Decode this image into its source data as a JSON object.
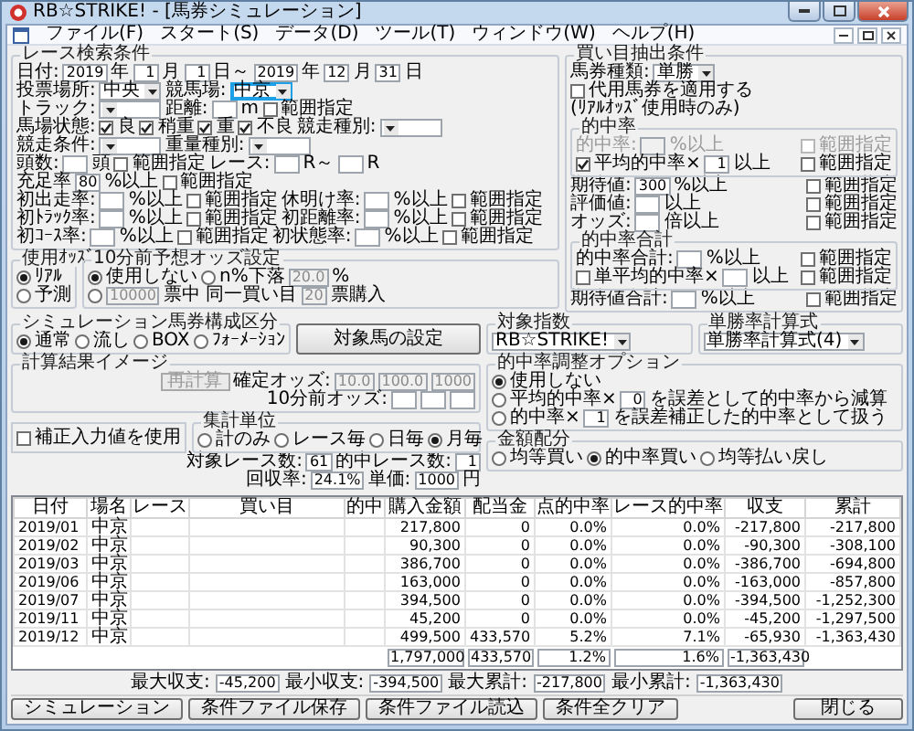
{
  "window": {
    "title": "RB☆STRIKE! - [馬券シミュレーション]"
  },
  "menu": [
    "ファイル(F)",
    "スタート(S)",
    "データ(D)",
    "ツール(T)",
    "ウィンドウ(W)",
    "ヘルプ(H)"
  ],
  "race_conditions": {
    "title": "レース検索条件",
    "rows": [
      {
        "parts": [
          {
            "kind": "label",
            "text": "日付:"
          },
          {
            "kind": "field",
            "value": "2019"
          },
          {
            "kind": "label",
            "text": "年"
          },
          {
            "kind": "field",
            "value": "1"
          },
          {
            "kind": "label",
            "text": "月"
          },
          {
            "kind": "field",
            "value": "1"
          },
          {
            "kind": "label",
            "text": "日～"
          },
          {
            "kind": "field",
            "value": "2019"
          },
          {
            "kind": "label",
            "text": "年"
          },
          {
            "kind": "field",
            "value": "12"
          },
          {
            "kind": "label",
            "text": "月"
          },
          {
            "kind": "field",
            "value": "31"
          },
          {
            "kind": "label",
            "text": "日"
          }
        ]
      },
      {
        "parts": [
          {
            "kind": "label",
            "text": "投票場所:"
          },
          {
            "kind": "select",
            "value": "中央"
          },
          {
            "kind": "label",
            "text": "競馬場:"
          },
          {
            "kind": "select",
            "value": "中京",
            "focused": true
          }
        ]
      },
      {
        "parts": [
          {
            "kind": "label",
            "text": "トラック:"
          },
          {
            "kind": "select"
          },
          {
            "kind": "label",
            "text": "距離:"
          },
          {
            "kind": "field"
          },
          {
            "kind": "label",
            "text": "m"
          },
          {
            "kind": "check",
            "label": "範囲指定",
            "checked": false
          }
        ]
      },
      {
        "parts": [
          {
            "kind": "label",
            "text": "馬場状態:"
          },
          {
            "kind": "check",
            "label": "良",
            "checked": true
          },
          {
            "kind": "check",
            "label": "稍重",
            "checked": true
          },
          {
            "kind": "check",
            "label": "重",
            "checked": true
          },
          {
            "kind": "check",
            "label": "不良",
            "checked": true
          },
          {
            "kind": "label",
            "text": "競走種別:"
          },
          {
            "kind": "select"
          }
        ]
      },
      {
        "parts": [
          {
            "kind": "label",
            "text": "競走条件:"
          },
          {
            "kind": "select"
          },
          {
            "kind": "label",
            "text": "重量種別:"
          },
          {
            "kind": "select"
          }
        ]
      },
      {
        "parts": [
          {
            "kind": "label",
            "text": "頭数:"
          },
          {
            "kind": "field"
          },
          {
            "kind": "label",
            "text": "頭"
          },
          {
            "kind": "check",
            "label": "範囲指定",
            "checked": false
          },
          {
            "kind": "label",
            "text": "レース:"
          },
          {
            "kind": "field"
          },
          {
            "kind": "label",
            "text": "R～"
          },
          {
            "kind": "field"
          },
          {
            "kind": "label",
            "text": "R"
          }
        ]
      },
      {
        "parts": [
          {
            "kind": "label",
            "text": "充足率"
          },
          {
            "kind": "field",
            "value": "80"
          },
          {
            "kind": "label",
            "text": "%以上"
          },
          {
            "kind": "check",
            "label": "範囲指定",
            "checked": false
          }
        ]
      },
      {
        "parts": [
          {
            "kind": "label",
            "text": "初出走率:"
          },
          {
            "kind": "field"
          },
          {
            "kind": "label",
            "text": "%以上"
          },
          {
            "kind": "check",
            "label": "範囲指定",
            "checked": false
          },
          {
            "kind": "label",
            "text": "休明け率:"
          },
          {
            "kind": "field"
          },
          {
            "kind": "label",
            "text": "%以上"
          },
          {
            "kind": "check",
            "label": "範囲指定",
            "checked": false
          }
        ]
      },
      {
        "parts": [
          {
            "kind": "label",
            "text": "初ﾄﾗｯｸ率:"
          },
          {
            "kind": "field"
          },
          {
            "kind": "label",
            "text": "%以上"
          },
          {
            "kind": "check",
            "label": "範囲指定",
            "checked": false
          },
          {
            "kind": "label",
            "text": "初距離率:"
          },
          {
            "kind": "field"
          },
          {
            "kind": "label",
            "text": "%以上"
          },
          {
            "kind": "check",
            "label": "範囲指定",
            "checked": false
          }
        ]
      },
      {
        "parts": [
          {
            "kind": "label",
            "text": "初ｺｰｽ率:"
          },
          {
            "kind": "field"
          },
          {
            "kind": "label",
            "text": "%以上"
          },
          {
            "kind": "check",
            "label": "範囲指定",
            "checked": false
          },
          {
            "kind": "label",
            "text": "初状態率:"
          },
          {
            "kind": "field"
          },
          {
            "kind": "label",
            "text": "%以上"
          },
          {
            "kind": "check",
            "label": "範囲指定",
            "checked": false
          }
        ]
      }
    ]
  },
  "bet_conditions": {
    "title": "買い目抽出条件",
    "rows": [
      {
        "parts": [
          {
            "kind": "label",
            "text": "馬券種類:"
          },
          {
            "kind": "select",
            "value": "単勝"
          }
        ]
      },
      {
        "parts": [
          {
            "kind": "check",
            "label": "代用馬券を適用する",
            "checked": false
          }
        ]
      },
      {
        "parts": [
          {
            "kind": "label",
            "text": "(ﾘｱﾙｵｯｽﾞ使用時のみ)"
          }
        ]
      },
      {
        "title": "的中率",
        "rows": [
          {
            "parts": [
              {
                "kind": "label",
                "text": "的中率:",
                "disabled": true
              },
              {
                "kind": "field",
                "disabled": true
              },
              {
                "kind": "label",
                "text": "%以上",
                "disabled": true
              },
              {
                "kind": "check",
                "label": "範囲指定",
                "checked": false,
                "disabled": true
              }
            ]
          },
          {
            "parts": [
              {
                "kind": "check",
                "label": "平均的中率×",
                "checked": true
              },
              {
                "kind": "field",
                "value": "1"
              },
              {
                "kind": "label",
                "text": "以上"
              },
              {
                "kind": "check",
                "label": "範囲指定",
                "checked": false
              }
            ]
          }
        ]
      },
      {
        "parts": [
          {
            "kind": "label",
            "text": "期待値:"
          },
          {
            "kind": "field",
            "value": "300"
          },
          {
            "kind": "label",
            "text": "%以上"
          },
          {
            "kind": "check",
            "label": "範囲指定",
            "checked": false
          }
        ]
      },
      {
        "parts": [
          {
            "kind": "label",
            "text": "評価値:"
          },
          {
            "kind": "field"
          },
          {
            "kind": "label",
            "text": "以上"
          },
          {
            "kind": "check",
            "label": "範囲指定",
            "checked": false
          }
        ]
      },
      {
        "parts": [
          {
            "kind": "label",
            "text": "オッズ:"
          },
          {
            "kind": "field"
          },
          {
            "kind": "label",
            "text": "倍以上"
          },
          {
            "kind": "check",
            "label": "範囲指定",
            "checked": false
          }
        ]
      },
      {
        "title": "的中率合計",
        "rows": [
          {
            "parts": [
              {
                "kind": "label",
                "text": "的中率合計:"
              },
              {
                "kind": "field"
              },
              {
                "kind": "label",
                "text": "%以上"
              },
              {
                "kind": "check",
                "label": "範囲指定",
                "checked": false
              }
            ]
          },
          {
            "parts": [
              {
                "kind": "check",
                "label": "単平均的中率×",
                "checked": false
              },
              {
                "kind": "field"
              },
              {
                "kind": "label",
                "text": "以上"
              },
              {
                "kind": "check",
                "label": "範囲指定",
                "checked": false
              }
            ]
          }
        ]
      },
      {
        "parts": [
          {
            "kind": "label",
            "text": "期待値合計:"
          },
          {
            "kind": "field"
          },
          {
            "kind": "label",
            "text": "%以上"
          },
          {
            "kind": "check",
            "label": "範囲指定",
            "checked": false
          }
        ]
      }
    ]
  },
  "simulation": {
    "composition": {
      "title": "シミュレーション馬券構成区分",
      "rows": [
        {
          "parts": [
            {
              "kind": "radio",
              "label": "通常",
              "selected": true
            },
            {
              "kind": "radio",
              "label": "流し",
              "selected": false
            },
            {
              "kind": "radio",
              "label": "BOX",
              "selected": false
            },
            {
              "kind": "radio",
              "label": "ﾌｫｰﾒｰｼｮﾝ",
              "selected": false
            }
          ]
        }
      ]
    },
    "target_button": "対象馬の設定",
    "odds_use": {
      "title": "使用ｵｯｽﾞ",
      "rows": [
        {
          "parts": [
            {
              "kind": "radio",
              "label": "ﾘｱﾙ",
              "selected": true
            }
          ]
        },
        {
          "parts": [
            {
              "kind": "radio",
              "label": "予測",
              "selected": false
            }
          ]
        }
      ]
    },
    "pre_odds": {
      "title": "10分前予想オッズ設定",
      "rows": [
        {
          "parts": [
            {
              "kind": "radio",
              "label": "使用しない",
              "selected": true
            },
            {
              "kind": "radio",
              "label": "n%下落",
              "selected": false
            },
            {
              "kind": "field",
              "value": "20.0",
              "disabled": true
            },
            {
              "kind": "label",
              "text": "%"
            }
          ]
        },
        {
          "parts": [
            {
              "kind": "radio",
              "selected": false
            },
            {
              "kind": "field",
              "value": "10000",
              "disabled": true
            },
            {
              "kind": "label",
              "text": "票中 同一買い目"
            },
            {
              "kind": "field",
              "value": "20",
              "disabled": true
            },
            {
              "kind": "label",
              "text": "票購入"
            }
          ]
        }
      ]
    },
    "result_image": {
      "title": "計算結果イメージ",
      "rows": [
        {
          "parts": [
            {
              "kind": "button",
              "label": "再計算",
              "disabled": true
            },
            {
              "kind": "label",
              "text": "確定オッズ:"
            },
            {
              "kind": "field",
              "value": "10.0",
              "disabled": true
            },
            {
              "kind": "field",
              "value": "100.0",
              "disabled": true
            },
            {
              "kind": "field",
              "value": "1000",
              "disabled": true
            }
          ]
        },
        {
          "parts": [
            {
              "kind": "label",
              "text": "10分前オッズ:"
            },
            {
              "kind": "field"
            },
            {
              "kind": "field"
            },
            {
              "kind": "field"
            }
          ]
        }
      ]
    },
    "correction": {
      "kind": "check",
      "label": "補正入力値を使用",
      "checked": false
    },
    "aggregation": {
      "title": "集計単位",
      "rows": [
        {
          "parts": [
            {
              "kind": "radio",
              "label": "計のみ",
              "selected": false
            },
            {
              "kind": "radio",
              "label": "レース毎",
              "selected": false
            },
            {
              "kind": "radio",
              "label": "日毎",
              "selected": false
            },
            {
              "kind": "radio",
              "label": "月毎",
              "selected": true
            }
          ]
        }
      ]
    },
    "allocation": {
      "title": "金額配分",
      "rows": [
        {
          "parts": [
            {
              "kind": "radio",
              "label": "均等買い",
              "selected": false
            },
            {
              "kind": "radio",
              "label": "的中率買い",
              "selected": true
            },
            {
              "kind": "radio",
              "label": "均等払い戻し",
              "selected": false
            }
          ]
        }
      ]
    },
    "index": {
      "title": "対象指数",
      "rows": [
        {
          "parts": [
            {
              "kind": "select",
              "value": "RB☆STRIKE!"
            }
          ]
        }
      ]
    },
    "formula": {
      "title": "単勝率計算式",
      "rows": [
        {
          "parts": [
            {
              "kind": "select",
              "value": "単勝率計算式(4)"
            }
          ]
        }
      ]
    },
    "adjust": {
      "title": "的中率調整オプション",
      "rows": [
        {
          "parts": [
            {
              "kind": "radio",
              "label": "使用しない",
              "selected": true
            }
          ]
        },
        {
          "parts": [
            {
              "kind": "radio",
              "label": "平均的中率×",
              "selected": false
            },
            {
              "kind": "field",
              "value": "0"
            },
            {
              "kind": "label",
              "text": "を誤差として的中率から減算"
            }
          ]
        },
        {
          "parts": [
            {
              "kind": "radio",
              "label": "的中率×",
              "selected": false
            },
            {
              "kind": "field",
              "value": "1"
            },
            {
              "kind": "label",
              "text": "を誤差補正した的中率として扱う"
            }
          ]
        }
      ]
    },
    "counts": [
      {
        "parts": [
          {
            "kind": "label",
            "text": "対象レース数:"
          },
          {
            "kind": "field",
            "value": "61"
          },
          {
            "kind": "label",
            "text": "的中レース数:"
          },
          {
            "kind": "field",
            "value": "1"
          }
        ]
      },
      {
        "parts": [
          {
            "kind": "label",
            "text": "回収率:"
          },
          {
            "kind": "field",
            "value": "24.1%"
          },
          {
            "kind": "label",
            "text": "単価:"
          },
          {
            "kind": "field",
            "value": "1000"
          },
          {
            "kind": "label",
            "text": "円"
          }
        ]
      }
    ]
  },
  "table": {
    "columns": [
      "日付",
      "場名",
      "レース",
      "買い目",
      "的中",
      "購入金額",
      "配当金",
      "点的中率",
      "レース的中率",
      "収支",
      "累計"
    ],
    "rows": [
      {
        "date": "2019/01",
        "venue": "中京",
        "amount": "217,800",
        "payout": "0",
        "point_rate": "0.0%",
        "race_rate": "0.0%",
        "balance": "-217,800",
        "total": "-217,800"
      },
      {
        "date": "2019/02",
        "venue": "中京",
        "amount": "90,300",
        "payout": "0",
        "point_rate": "0.0%",
        "race_rate": "0.0%",
        "balance": "-90,300",
        "total": "-308,100"
      },
      {
        "date": "2019/03",
        "venue": "中京",
        "amount": "386,700",
        "payout": "0",
        "point_rate": "0.0%",
        "race_rate": "0.0%",
        "balance": "-386,700",
        "total": "-694,800"
      },
      {
        "date": "2019/06",
        "venue": "中京",
        "amount": "163,000",
        "payout": "0",
        "point_rate": "0.0%",
        "race_rate": "0.0%",
        "balance": "-163,000",
        "total": "-857,800"
      },
      {
        "date": "2019/07",
        "venue": "中京",
        "amount": "394,500",
        "payout": "0",
        "point_rate": "0.0%",
        "race_rate": "0.0%",
        "balance": "-394,500",
        "total": "-1,252,300"
      },
      {
        "date": "2019/11",
        "venue": "中京",
        "amount": "45,200",
        "payout": "0",
        "point_rate": "0.0%",
        "race_rate": "0.0%",
        "balance": "-45,200",
        "total": "-1,297,500"
      },
      {
        "date": "2019/12",
        "venue": "中京",
        "amount": "499,500",
        "payout": "433,570",
        "point_rate": "5.2%",
        "race_rate": "7.1%",
        "balance": "-65,930",
        "total": "-1,363,430"
      }
    ],
    "totals": {
      "amount": "1,797,000",
      "payout": "433,570",
      "point_rate": "1.2%",
      "race_rate": "1.6%",
      "balance": "-1,363,430"
    }
  },
  "summary": [
    {
      "label": "最大収支:",
      "value": "-45,200"
    },
    {
      "label": "最小収支:",
      "value": "-394,500"
    },
    {
      "label": "最大累計:",
      "value": "-217,800"
    },
    {
      "label": "最小累計:",
      "value": "-1,363,430"
    }
  ],
  "buttons": [
    "シミュレーション",
    "条件ファイル保存",
    "条件ファイル読込",
    "条件全クリア"
  ],
  "close_button": "閉じる"
}
